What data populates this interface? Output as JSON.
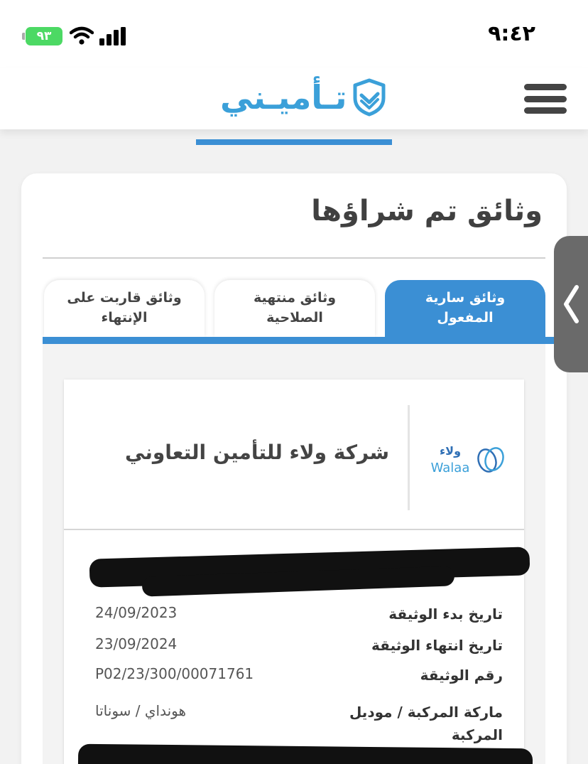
{
  "status_bar": {
    "time": "٩:٤٢",
    "battery": "٩٣",
    "accent_color": "#4cd964"
  },
  "header": {
    "logo_text": "تـأميـني",
    "brand_color": "#3ba0d9",
    "icons": [
      "shield-icon",
      "menu-icon"
    ]
  },
  "page": {
    "title": "وثائق تم شراؤها",
    "accent_color": "#3b8fd4"
  },
  "tabs": [
    {
      "label": "وثائق سارية المفعول",
      "active": true
    },
    {
      "label": "وثائق منتهية الصلاحية",
      "active": false
    },
    {
      "label": "وثائق قاربت على الإنتهاء",
      "active": false
    }
  ],
  "policy": {
    "company_name": "شركة ولاء للتأمين التعاوني",
    "company_logo_ar": "ولاء",
    "company_logo_en": "Walaa",
    "rows": [
      {
        "label": "تاريخ بدء الوثيقة",
        "value": "24/09/2023"
      },
      {
        "label": "تاريخ انتهاء الوثيقة",
        "value": "23/09/2024"
      },
      {
        "label": "رقم الوثيقة",
        "value": "P02/23/300/00071761"
      },
      {
        "label": "ماركة المركبة / موديل المركبة",
        "value": "هونداي / سوناتا"
      }
    ]
  }
}
